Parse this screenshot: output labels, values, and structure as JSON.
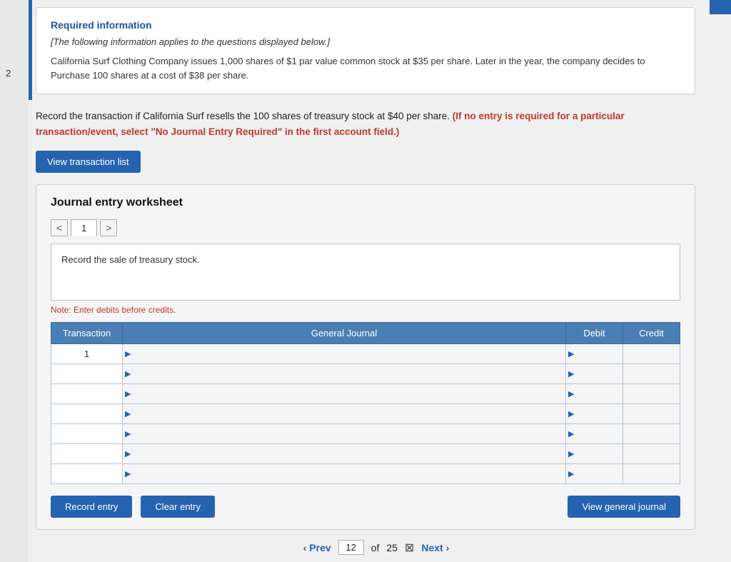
{
  "page": {
    "sidebar_number": "2",
    "top_right_accent": "#2563b0"
  },
  "required_info": {
    "title": "Required information",
    "italic_text": "[The following information applies to the questions displayed below.]",
    "body_text": "California Surf Clothing Company issues 1,000 shares of $1 par value common stock at $35 per share. Later in the year, the company decides to Purchase 100 shares at a cost of $38 per share."
  },
  "instruction": {
    "text_part1": "Record the transaction if California Surf resells the 100 shares of treasury stock at $40 per share. ",
    "text_bold_red": "(If no entry is required for a particular transaction/event, select \"No Journal Entry Required\" in the first account field.)"
  },
  "buttons": {
    "view_transaction_list": "View transaction list",
    "record_entry": "Record entry",
    "clear_entry": "Clear entry",
    "view_general_journal": "View general journal"
  },
  "journal_worksheet": {
    "title": "Journal entry worksheet",
    "tab_number": "1",
    "nav_prev_label": "<",
    "nav_next_label": ">",
    "record_desc": "Record the sale of treasury stock.",
    "note": "Note: Enter debits before credits.",
    "table": {
      "headers": [
        "Transaction",
        "General Journal",
        "Debit",
        "Credit"
      ],
      "rows": [
        {
          "transaction": "1",
          "general_journal": "",
          "debit": "",
          "credit": ""
        },
        {
          "transaction": "",
          "general_journal": "",
          "debit": "",
          "credit": ""
        },
        {
          "transaction": "",
          "general_journal": "",
          "debit": "",
          "credit": ""
        },
        {
          "transaction": "",
          "general_journal": "",
          "debit": "",
          "credit": ""
        },
        {
          "transaction": "",
          "general_journal": "",
          "debit": "",
          "credit": ""
        },
        {
          "transaction": "",
          "general_journal": "",
          "debit": "",
          "credit": ""
        },
        {
          "transaction": "",
          "general_journal": "",
          "debit": "",
          "credit": ""
        }
      ]
    }
  },
  "pagination": {
    "prev_label": "Prev",
    "next_label": "Next",
    "current_page": "12",
    "total_pages": "25"
  }
}
